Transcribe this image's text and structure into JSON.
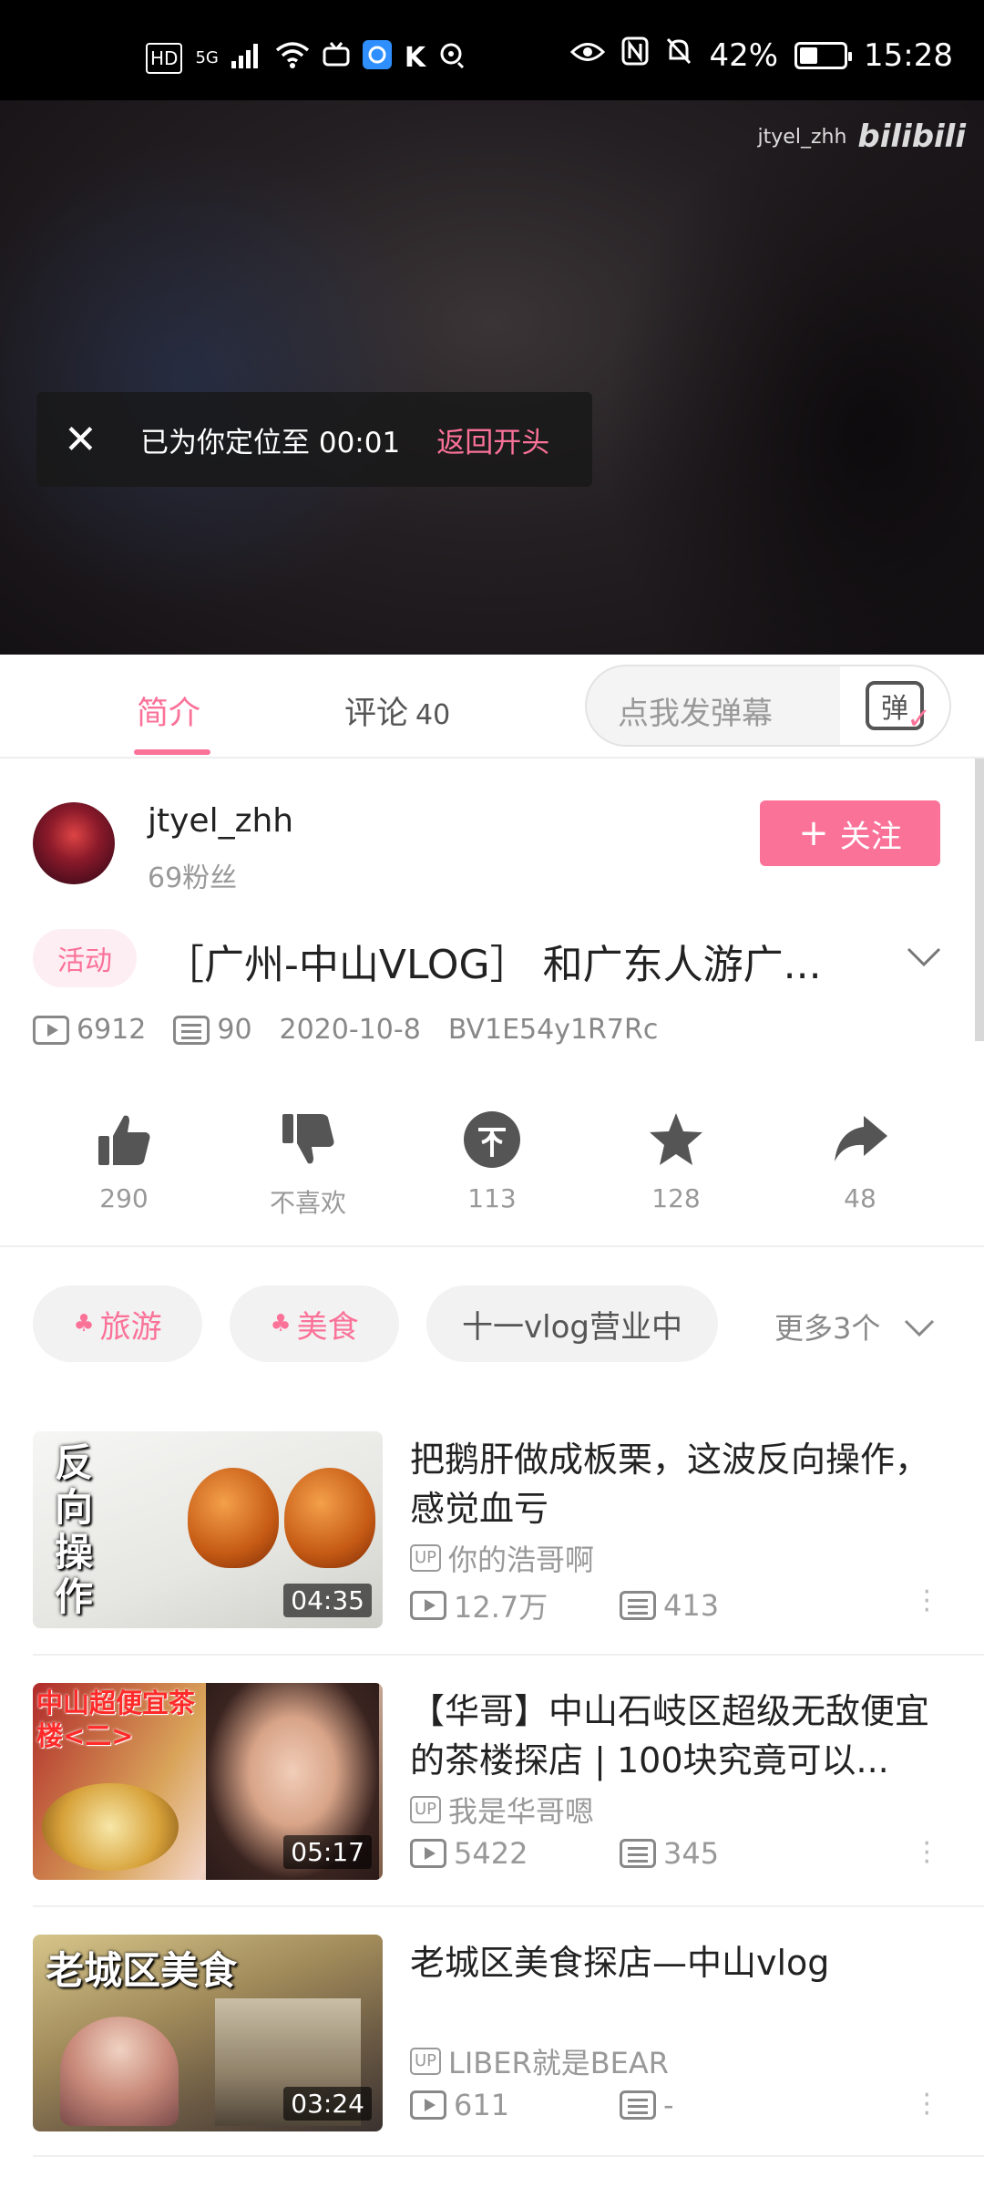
{
  "status_bar": {
    "left_icons": [
      "HD",
      "5G",
      "signal-icon",
      "wifi-icon",
      "tv-icon",
      "app-icon",
      "k-icon",
      "hotspot-icon"
    ],
    "battery_percent": "42%",
    "battery_level": 0.42,
    "time": "15:28"
  },
  "video": {
    "watermark_user": "jtyel_zhh",
    "watermark_logo": "bilibili",
    "toast_message": "已为你定位至 00:01",
    "toast_action": "返回开头"
  },
  "tabs": [
    {
      "label": "简介",
      "count": ""
    },
    {
      "label": "评论",
      "count": "40"
    }
  ],
  "danmaku": {
    "placeholder": "点我发弹幕",
    "button_glyph": "弹"
  },
  "uploader": {
    "name": "jtyel_zhh",
    "fans": "69粉丝",
    "follow_label": "关注"
  },
  "video_info": {
    "badge": "活动",
    "title": "［广州-中山VLOG］ 和广东人游广...",
    "views": "6912",
    "danmaku_count": "90",
    "date": "2020-10-8",
    "bvid": "BV1E54y1R7Rc"
  },
  "actions": [
    {
      "icon": "thumbs-up-icon",
      "label": "290"
    },
    {
      "icon": "thumbs-down-icon",
      "label": "不喜欢"
    },
    {
      "icon": "coin-icon",
      "label": "113"
    },
    {
      "icon": "star-icon",
      "label": "128"
    },
    {
      "icon": "share-icon",
      "label": "48"
    }
  ],
  "tags": [
    {
      "label": "旅游",
      "style": "pink"
    },
    {
      "label": "美食",
      "style": "pink"
    },
    {
      "label": "十一vlog营业中",
      "style": "gray"
    }
  ],
  "more_tags": "更多3个",
  "related": [
    {
      "title": "把鹅肝做成板栗，这波反向操作，感觉血亏",
      "thumb_text": "反向操作",
      "duration": "04:35",
      "uploader": "你的浩哥啊",
      "views": "12.7万",
      "danmaku": "413"
    },
    {
      "title": "【华哥】中山石岐区超级无敌便宜的茶楼探店 | 100块究竟可以...",
      "thumb_text": "中山超便宜茶楼<二>",
      "duration": "05:17",
      "uploader": "我是华哥嗯",
      "views": "5422",
      "danmaku": "345"
    },
    {
      "title": "老城区美食探店—中山vlog",
      "thumb_text": "老城区美食",
      "duration": "03:24",
      "uploader": "LIBER就是BEAR",
      "views": "611",
      "danmaku": "-"
    }
  ],
  "colors": {
    "accent": "#fb7299",
    "text_primary": "#222222",
    "text_secondary": "#999999"
  }
}
